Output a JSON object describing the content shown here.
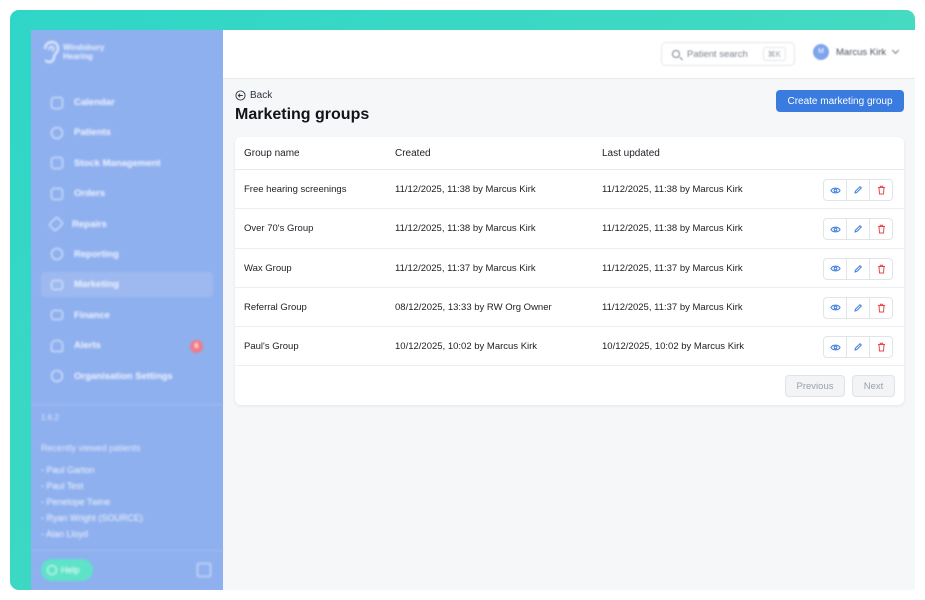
{
  "sidebar": {
    "logo_line1": "Windsbury",
    "logo_line2": "Hearing",
    "items": [
      {
        "label": "Calendar"
      },
      {
        "label": "Patients"
      },
      {
        "label": "Stock Management"
      },
      {
        "label": "Orders"
      },
      {
        "label": "Repairs"
      },
      {
        "label": "Reporting"
      },
      {
        "label": "Marketing"
      },
      {
        "label": "Finance"
      },
      {
        "label": "Alerts",
        "badge": "6"
      },
      {
        "label": "Organisation Settings"
      }
    ],
    "active_item": "Marketing",
    "version": "1.6.2",
    "recent_title": "Recently viewed patients",
    "recent": [
      "- Paul Garton",
      "- Paul Test",
      "- Penelope Twine",
      "- Ryan Wright (SOURCE)",
      "- Alan Lloyd"
    ],
    "help_label": "Help"
  },
  "topbar": {
    "search_placeholder": "Patient search",
    "search_shortcut": "⌘K",
    "user_initials": "M",
    "user_name": "Marcus Kirk"
  },
  "page": {
    "back_label": "Back",
    "title": "Marketing groups",
    "create_label": "Create marketing group"
  },
  "table": {
    "headers": [
      "Group name",
      "Created",
      "Last updated"
    ],
    "rows": [
      {
        "name": "Free hearing screenings",
        "created": "11/12/2025, 11:38 by Marcus Kirk",
        "updated": "11/12/2025, 11:38 by Marcus Kirk"
      },
      {
        "name": "Over 70's Group",
        "created": "11/12/2025, 11:38 by Marcus Kirk",
        "updated": "11/12/2025, 11:38 by Marcus Kirk"
      },
      {
        "name": "Wax Group",
        "created": "11/12/2025, 11:37 by Marcus Kirk",
        "updated": "11/12/2025, 11:37 by Marcus Kirk"
      },
      {
        "name": "Referral Group",
        "created": "08/12/2025, 13:33 by RW Org Owner",
        "updated": "11/12/2025, 11:37 by Marcus Kirk"
      },
      {
        "name": "Paul's Group",
        "created": "10/12/2025, 10:02 by Marcus Kirk",
        "updated": "10/12/2025, 10:02 by Marcus Kirk"
      }
    ],
    "previous_label": "Previous",
    "next_label": "Next"
  },
  "colors": {
    "accent": "#3a7be0",
    "sidebar": "#8fb0ef",
    "frame": "#3fd9c2",
    "danger": "#e5484d"
  }
}
